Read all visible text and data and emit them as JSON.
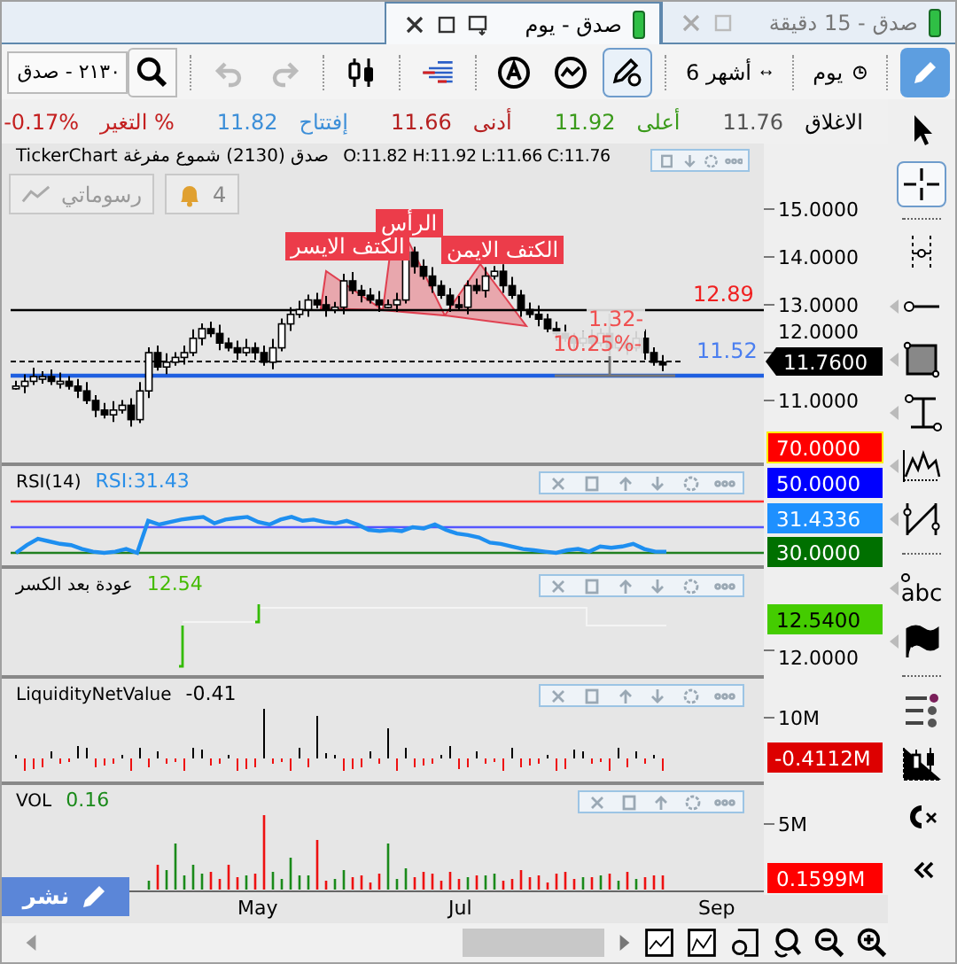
{
  "tabs": [
    {
      "label": "صدق - 15 دقيقة",
      "selected": false
    },
    {
      "label": "صدق - يوم",
      "selected": true
    }
  ],
  "toolbar": {
    "interval": "يوم",
    "period": "6 أشهر",
    "search": {
      "value": "٢١٣٠ - صدق"
    }
  },
  "quote": [
    {
      "label": "الاغلاق",
      "value": "11.76",
      "color": "#555555"
    },
    {
      "label": "أعلى",
      "value": "11.92",
      "color": "#3a9a1a"
    },
    {
      "label": "أدنى",
      "value": "11.66",
      "color": "#b52020"
    },
    {
      "label": "إفتتاح",
      "value": "11.82",
      "color": "#3d8fd8"
    },
    {
      "label": "التغير %",
      "value": "-0.17%",
      "color": "#c42020"
    }
  ],
  "main_chart": {
    "title": "TickerChart صدق (2130) شموع مفرغة",
    "ohlc": "O:11.82 H:11.92 L:11.66 C:11.76",
    "drawings_button": "رسوماتي",
    "alerts_badge": "4",
    "pattern_labels": [
      "الكتف الايسر",
      "الرأس",
      "الكتف الايمن"
    ],
    "resistance": "12.89",
    "support": "11.52",
    "measure_change": "1.32-",
    "measure_percent": "10.25%-",
    "price_axis": [
      "15.0000",
      "14.0000",
      "13.0000",
      "12.0000",
      "11.0000"
    ],
    "last_price": "11.7600"
  },
  "rsi": {
    "title": "RSI(14)",
    "value": "RSI:31.43",
    "tags": [
      {
        "text": "70.0000",
        "color": "#ff0000"
      },
      {
        "text": "50.0000",
        "color": "#0000ff"
      },
      {
        "text": "31.4336",
        "color": "#1e90ff"
      },
      {
        "text": "30.0000",
        "color": "#007000"
      }
    ]
  },
  "return_panel": {
    "title": "عودة بعد الكسر",
    "value": "12.54",
    "axis": [
      "12.0000"
    ],
    "tag": "12.5400"
  },
  "liquidity": {
    "title": "LiquidityNetValue",
    "value": "-0.41",
    "axis": [
      "10M"
    ],
    "tag": "-0.4112M"
  },
  "volume": {
    "title": "VOL",
    "value": "0.16",
    "axis": [
      "5M"
    ],
    "tag": "0.1599M"
  },
  "x_axis": [
    "Sep",
    "Jul",
    "May"
  ],
  "publish_button": "نشر",
  "sidebar": {
    "text_tool": "abc"
  }
}
